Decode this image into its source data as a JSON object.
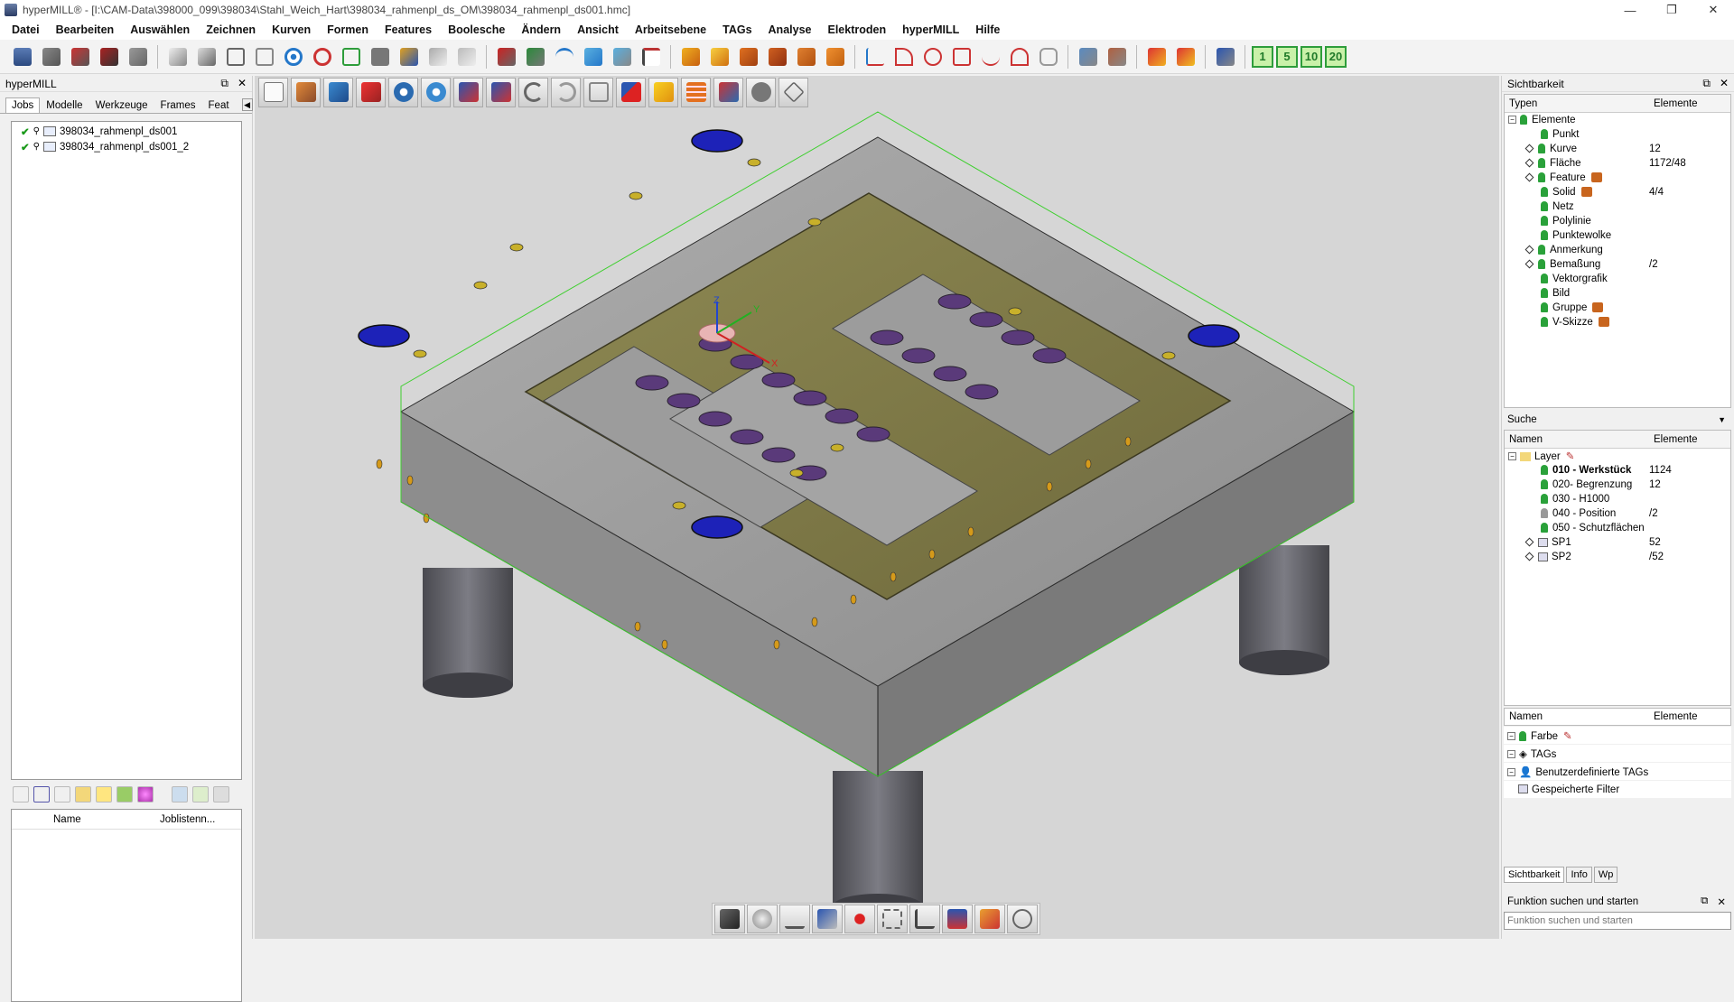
{
  "window": {
    "title": "hyperMILL® - [I:\\CAM-Data\\398000_099\\398034\\Stahl_Weich_Hart\\398034_rahmenpl_ds_OM\\398034_rahmenpl_ds001.hmc]",
    "minimize": "—",
    "restore": "❐",
    "close": "✕"
  },
  "menu": [
    "Datei",
    "Bearbeiten",
    "Auswählen",
    "Zeichnen",
    "Kurven",
    "Formen",
    "Features",
    "Boolesche",
    "Ändern",
    "Ansicht",
    "Arbeitsebene",
    "TAGs",
    "Analyse",
    "Elektroden",
    "hyperMILL",
    "Hilfe"
  ],
  "toolbar": {
    "icons": [
      "layers-icon",
      "tools-icon",
      "magnet-icon",
      "stamp-icon",
      "brush-icon",
      "sep",
      "cube-solid-icon",
      "cube-shaded-icon",
      "cube-wire-icon",
      "cube-outline-icon",
      "target-icon",
      "no-target-icon",
      "h-mark-icon",
      "save-icon",
      "star-tool-icon",
      "knife-icon",
      "hammer-icon",
      "sep",
      "pin-icon",
      "tree-icon",
      "arc-icon",
      "shape-icon",
      "trim-icon",
      "text-tool-icon",
      "sep",
      "mill-a-icon",
      "mill-b-icon",
      "mill-c-icon",
      "mill-d-icon",
      "mill-e-icon",
      "mill-f-icon",
      "sep",
      "axis-icon",
      "curve-icon",
      "circle-icon",
      "rect-icon",
      "spline-icon",
      "spiral-icon",
      "hand-icon",
      "sep",
      "box-a-icon",
      "box-b-icon",
      "sep",
      "filter-icon",
      "flag-icon",
      "sep",
      "wand-icon"
    ],
    "numbers": [
      "1",
      "5",
      "10",
      "20"
    ]
  },
  "left_panel": {
    "title": "hyperMILL",
    "tabs": [
      "Jobs",
      "Modelle",
      "Werkzeuge",
      "Frames",
      "Feat"
    ],
    "jobs": [
      "398034_rahmenpl_ds001",
      "398034_rahmenpl_ds001_2"
    ],
    "list_columns": [
      "Name",
      "Joblistenn..."
    ]
  },
  "viewport": {
    "top_tools": [
      "page-icon",
      "box-icon",
      "rotate-icon",
      "tool-red-icon",
      "gear-icon",
      "gear-10-icon",
      "info-icon",
      "info-2-icon",
      "undo-icon",
      "redo-icon",
      "r-icon",
      "cube-red-icon",
      "warning-icon",
      "table-icon",
      "machine-icon",
      "p-icon",
      "diamond-icon"
    ],
    "bottom_tools": [
      "solid-view-icon",
      "sphere-view-icon",
      "edit-icon",
      "paint-icon",
      "star-icon",
      "zero-icon",
      "measure-icon",
      "pin-tool-icon",
      "pencil-icon",
      "globe-icon"
    ]
  },
  "right_panel": {
    "visibility_title": "Sichtbarkeit",
    "types_col": "Typen",
    "elements_col": "Elemente",
    "types": [
      {
        "name": "Elemente",
        "value": "",
        "level": 0
      },
      {
        "name": "Punkt",
        "value": "",
        "level": 1
      },
      {
        "name": "Kurve",
        "value": "12",
        "level": 1
      },
      {
        "name": "Fläche",
        "value": "1172/48",
        "level": 1
      },
      {
        "name": "Feature",
        "value": "",
        "level": 1
      },
      {
        "name": "Solid",
        "value": "4/4",
        "level": 1
      },
      {
        "name": "Netz",
        "value": "",
        "level": 1
      },
      {
        "name": "Polylinie",
        "value": "",
        "level": 1
      },
      {
        "name": "Punktewolke",
        "value": "",
        "level": 1
      },
      {
        "name": "Anmerkung",
        "value": "",
        "level": 1
      },
      {
        "name": "Bemaßung",
        "value": "/2",
        "level": 1
      },
      {
        "name": "Vektorgrafik",
        "value": "",
        "level": 1
      },
      {
        "name": "Bild",
        "value": "",
        "level": 1
      },
      {
        "name": "Gruppe",
        "value": "",
        "level": 1
      },
      {
        "name": "V-Skizze",
        "value": "",
        "level": 1
      }
    ],
    "search_title": "Suche",
    "names_col": "Namen",
    "elements_col2": "Elemente",
    "layers": [
      {
        "name": "Layer",
        "value": ""
      },
      {
        "name": "010 - Werkstück",
        "value": "1124"
      },
      {
        "name": "020- Begrenzung",
        "value": "12"
      },
      {
        "name": "030 - H1000",
        "value": ""
      },
      {
        "name": "040 - Position",
        "value": "/2"
      },
      {
        "name": "050 - Schutzflächen",
        "value": ""
      },
      {
        "name": "SP1",
        "value": "52"
      },
      {
        "name": "SP2",
        "value": "/52"
      }
    ],
    "names_col3": "Namen",
    "elements_col3": "Elemente",
    "filters": [
      "Farbe",
      "TAGs",
      "Benutzerdefinierte TAGs",
      "Gespeicherte Filter"
    ],
    "bottom_tabs": [
      "Sichtbarkeit",
      "Info",
      "Wp"
    ],
    "function_title": "Funktion suchen und starten",
    "function_placeholder": "Funktion suchen und starten"
  }
}
